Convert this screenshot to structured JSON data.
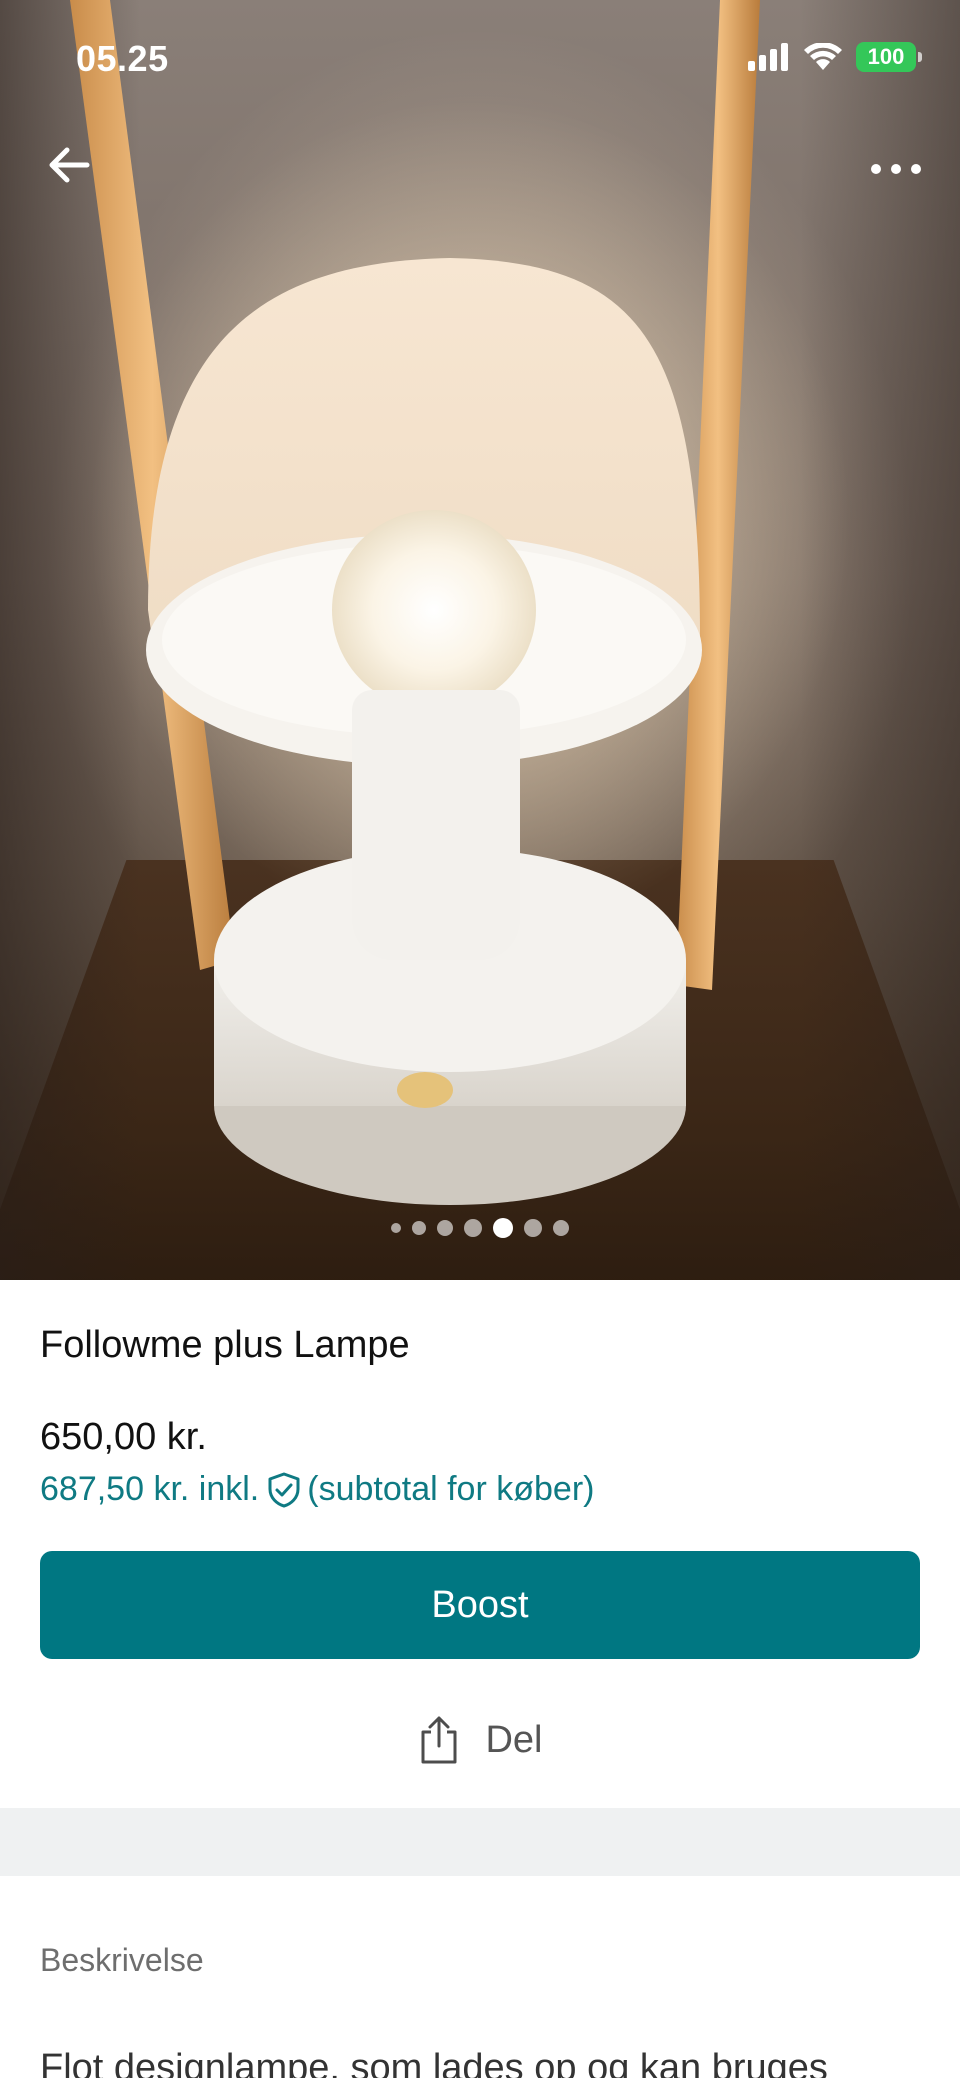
{
  "status_bar": {
    "time": "05.25",
    "battery": "100",
    "icons": [
      "signal-icon",
      "wifi-icon",
      "battery-icon"
    ]
  },
  "header": {
    "back_icon": "arrow-left-icon",
    "more_icon": "more-horizontal-icon"
  },
  "gallery": {
    "photo_count": 7,
    "active_index": 4
  },
  "item": {
    "title": "Followme plus Lampe",
    "price": "650,00 kr.",
    "price_incl_prefix": "687,50 kr. inkl.",
    "price_incl_suffix": "(subtotal for køber)",
    "shield_icon": "buyer-protection-shield-icon"
  },
  "actions": {
    "boost_label": "Boost",
    "share_label": "Del",
    "share_icon": "share-icon"
  },
  "description": {
    "heading": "Beskrivelse",
    "text": "Flot designlampe, som lades op og kan bruges"
  },
  "colors": {
    "accent": "#007782",
    "accent_text": "#0f7a83",
    "battery": "#34c759",
    "separator": "#eff1f2"
  }
}
